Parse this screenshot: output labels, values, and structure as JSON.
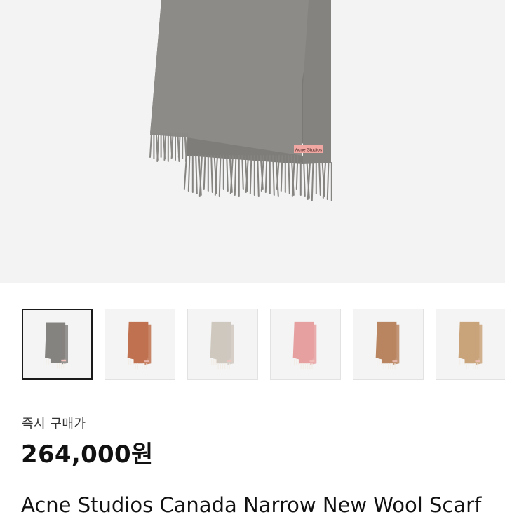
{
  "product": {
    "main_image": {
      "color": "#8b8986",
      "label_text": "Acne Studios",
      "label_color": "#f1a7a2"
    },
    "thumbnails": [
      {
        "color": "#858380",
        "selected": true
      },
      {
        "color": "#c0714f",
        "selected": false
      },
      {
        "color": "#cfc8bf",
        "selected": false
      },
      {
        "color": "#e7a0a0",
        "selected": false
      },
      {
        "color": "#b98460",
        "selected": false
      },
      {
        "color": "#c9a37a",
        "selected": false
      }
    ],
    "price_label": "즉시 구매가",
    "price": "264,000원",
    "title": "Acne Studios Canada Narrow New Wool Scarf"
  }
}
